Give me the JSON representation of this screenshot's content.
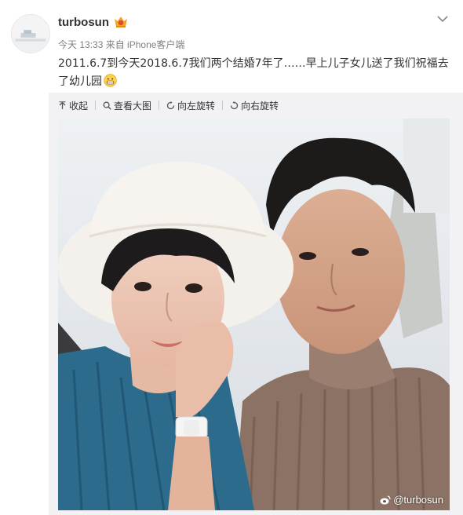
{
  "post": {
    "username": "turbosun",
    "time": "今天 13:33",
    "source": "来自 iPhone客户端",
    "content_text": "2011.6.7到今天2018.6.7我们两个结婚7年了……早上儿子女儿送了我们祝福去了幼儿园",
    "emoji_name": "grin-emoji"
  },
  "toolbar": {
    "collect": "收起",
    "view_large": "查看大图",
    "rotate_left": "向左旋转",
    "rotate_right": "向右旋转"
  },
  "photo": {
    "watermark": "@turbosun"
  },
  "icons": {
    "badge": "crown-badge-icon",
    "more": "chevron-down-icon",
    "collect": "arrow-up-icon",
    "view_large": "magnifier-icon",
    "rotate_left": "rotate-left-icon",
    "rotate_right": "rotate-right-icon",
    "watermark": "weibo-logo-icon"
  },
  "colors": {
    "text": "#333333",
    "meta": "#808080",
    "media_bg": "#f2f2f5"
  }
}
